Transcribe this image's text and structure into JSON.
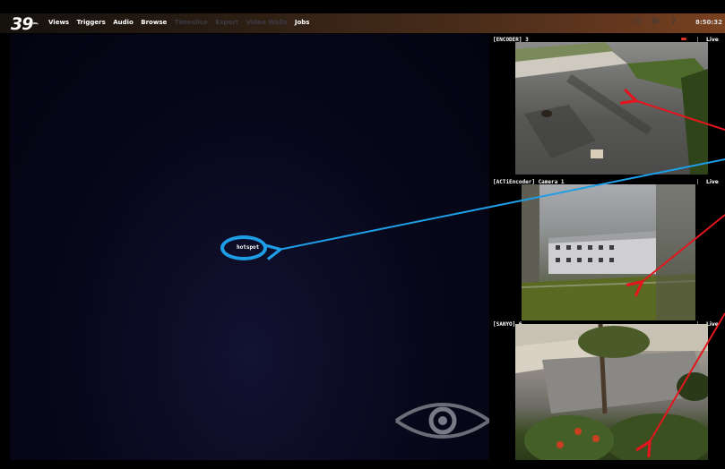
{
  "app": {
    "logo": "39"
  },
  "nav": {
    "items": [
      "Views",
      "Triggers",
      "Audio",
      "Browse",
      "Timeslice",
      "Export",
      "Video Walls",
      "Jobs"
    ]
  },
  "status": {
    "clock": "8:50:32"
  },
  "stage": {
    "hotspot_label": "hotspot"
  },
  "cameras": [
    {
      "title": "[ENCODER] 3",
      "live": "Live"
    },
    {
      "title": "[ACTiEncoder] Camera 1",
      "live": "Live"
    },
    {
      "title": "[SANYO] 6",
      "live": "Live"
    }
  ],
  "colors": {
    "annotation_blue": "#1e9ee6",
    "annotation_red": "#e2161d"
  },
  "icons": [
    "power-icon",
    "settings-icon",
    "help-icon",
    "logo-eye-icon"
  ]
}
